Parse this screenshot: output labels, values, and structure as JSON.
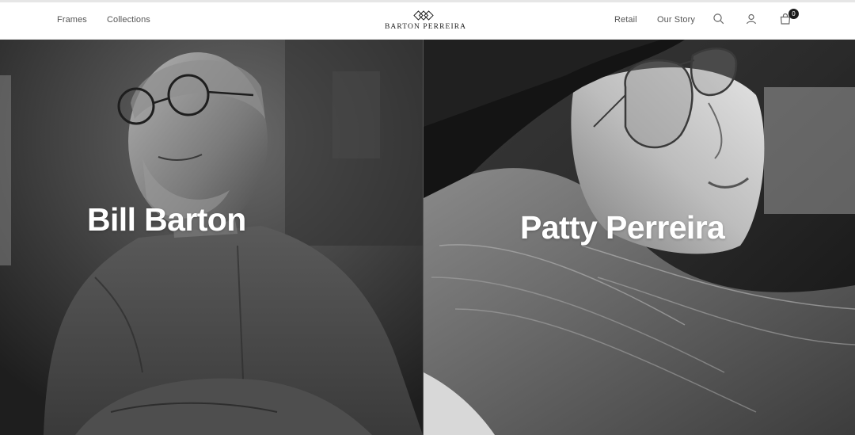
{
  "header": {
    "nav_left": [
      {
        "label": "Frames"
      },
      {
        "label": "Collections"
      }
    ],
    "logo_text": "BARTON PERREIRA",
    "nav_right": [
      {
        "label": "Retail"
      },
      {
        "label": "Our Story"
      }
    ],
    "icons": [
      "search-icon",
      "account-icon",
      "cart-icon"
    ],
    "cart_count": "0"
  },
  "panels": [
    {
      "name": "Bill Barton"
    },
    {
      "name": "Patty Perreira"
    }
  ],
  "colors": {
    "header_bg": "#ffffff",
    "nav_text": "#555555",
    "name_text": "#ffffff",
    "badge_bg": "#1a1a1a"
  }
}
